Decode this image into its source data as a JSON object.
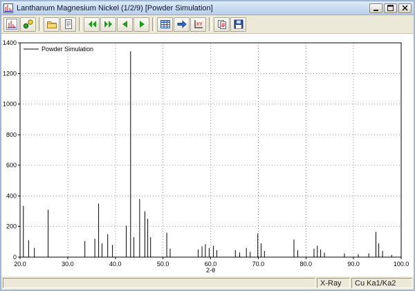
{
  "window": {
    "title": "Lanthanum Magnesium Nickel (1/2/9) [Powder Simulation]"
  },
  "toolbar": {
    "xy_label": "XY",
    "groups": [
      {
        "items": [
          {
            "icon": "powder-pattern-icon"
          },
          {
            "icon": "structure-picture-icon"
          }
        ]
      },
      {
        "items": [
          {
            "icon": "open-icon"
          },
          {
            "icon": "report-icon"
          }
        ]
      },
      {
        "items": [
          {
            "icon": "first-record-icon"
          },
          {
            "icon": "last-record-icon"
          },
          {
            "icon": "previous-record-icon"
          },
          {
            "icon": "next-record-icon"
          }
        ]
      },
      {
        "items": [
          {
            "icon": "data-table-icon"
          },
          {
            "icon": "profile-arrow-icon"
          },
          {
            "icon": "xy-data-icon"
          }
        ]
      },
      {
        "items": [
          {
            "icon": "copy-icon"
          },
          {
            "icon": "save-icon"
          }
        ]
      }
    ]
  },
  "statusbar": {
    "radiation": "X-Ray",
    "wavelength": "Cu Ka1/Ka2"
  },
  "chart_data": {
    "type": "line",
    "title": "",
    "legend": [
      "Powder Simulation"
    ],
    "xlabel": "2-θ",
    "ylabel": "",
    "xlim": [
      20,
      100
    ],
    "ylim": [
      0,
      1400
    ],
    "grid": true,
    "legend_position": "top-left-inside",
    "x_ticks": [
      {
        "v": 20,
        "label": "20.0"
      },
      {
        "v": 30,
        "label": "30.0"
      },
      {
        "v": 40,
        "label": "40.0"
      },
      {
        "v": 50,
        "label": "50.0"
      },
      {
        "v": 60,
        "label": "60.0"
      },
      {
        "v": 70,
        "label": "70.0"
      },
      {
        "v": 80,
        "label": "80.0"
      },
      {
        "v": 90,
        "label": "90.0"
      },
      {
        "v": 100,
        "label": "100.0"
      }
    ],
    "y_ticks": [
      {
        "v": 0,
        "label": "0"
      },
      {
        "v": 200,
        "label": "200"
      },
      {
        "v": 400,
        "label": "400"
      },
      {
        "v": 600,
        "label": "600"
      },
      {
        "v": 800,
        "label": "800"
      },
      {
        "v": 1000,
        "label": "1000"
      },
      {
        "v": 1200,
        "label": "1200"
      },
      {
        "v": 1400,
        "label": "1400"
      }
    ],
    "peaks": [
      [
        20.7,
        335
      ],
      [
        21.8,
        110
      ],
      [
        23.0,
        60
      ],
      [
        25.9,
        310
      ],
      [
        33.6,
        105
      ],
      [
        35.7,
        120
      ],
      [
        36.5,
        350
      ],
      [
        37.2,
        90
      ],
      [
        38.4,
        150
      ],
      [
        39.4,
        80
      ],
      [
        42.3,
        205
      ],
      [
        43.2,
        1345
      ],
      [
        43.9,
        130
      ],
      [
        45.1,
        380
      ],
      [
        46.2,
        300
      ],
      [
        46.8,
        250
      ],
      [
        47.4,
        130
      ],
      [
        50.8,
        160
      ],
      [
        51.5,
        55
      ],
      [
        57.4,
        50
      ],
      [
        58.2,
        70
      ],
      [
        58.9,
        85
      ],
      [
        59.7,
        60
      ],
      [
        60.6,
        75
      ],
      [
        61.3,
        45
      ],
      [
        65.2,
        45
      ],
      [
        66.1,
        30
      ],
      [
        67.5,
        60
      ],
      [
        68.3,
        35
      ],
      [
        69.9,
        155
      ],
      [
        70.6,
        90
      ],
      [
        71.3,
        40
      ],
      [
        77.5,
        115
      ],
      [
        78.3,
        45
      ],
      [
        81.7,
        55
      ],
      [
        82.4,
        75
      ],
      [
        83.1,
        50
      ],
      [
        83.9,
        30
      ],
      [
        88.1,
        25
      ],
      [
        91.0,
        20
      ],
      [
        93.2,
        25
      ],
      [
        94.7,
        165
      ],
      [
        95.3,
        90
      ],
      [
        96.1,
        40
      ],
      [
        98.0,
        15
      ]
    ]
  }
}
